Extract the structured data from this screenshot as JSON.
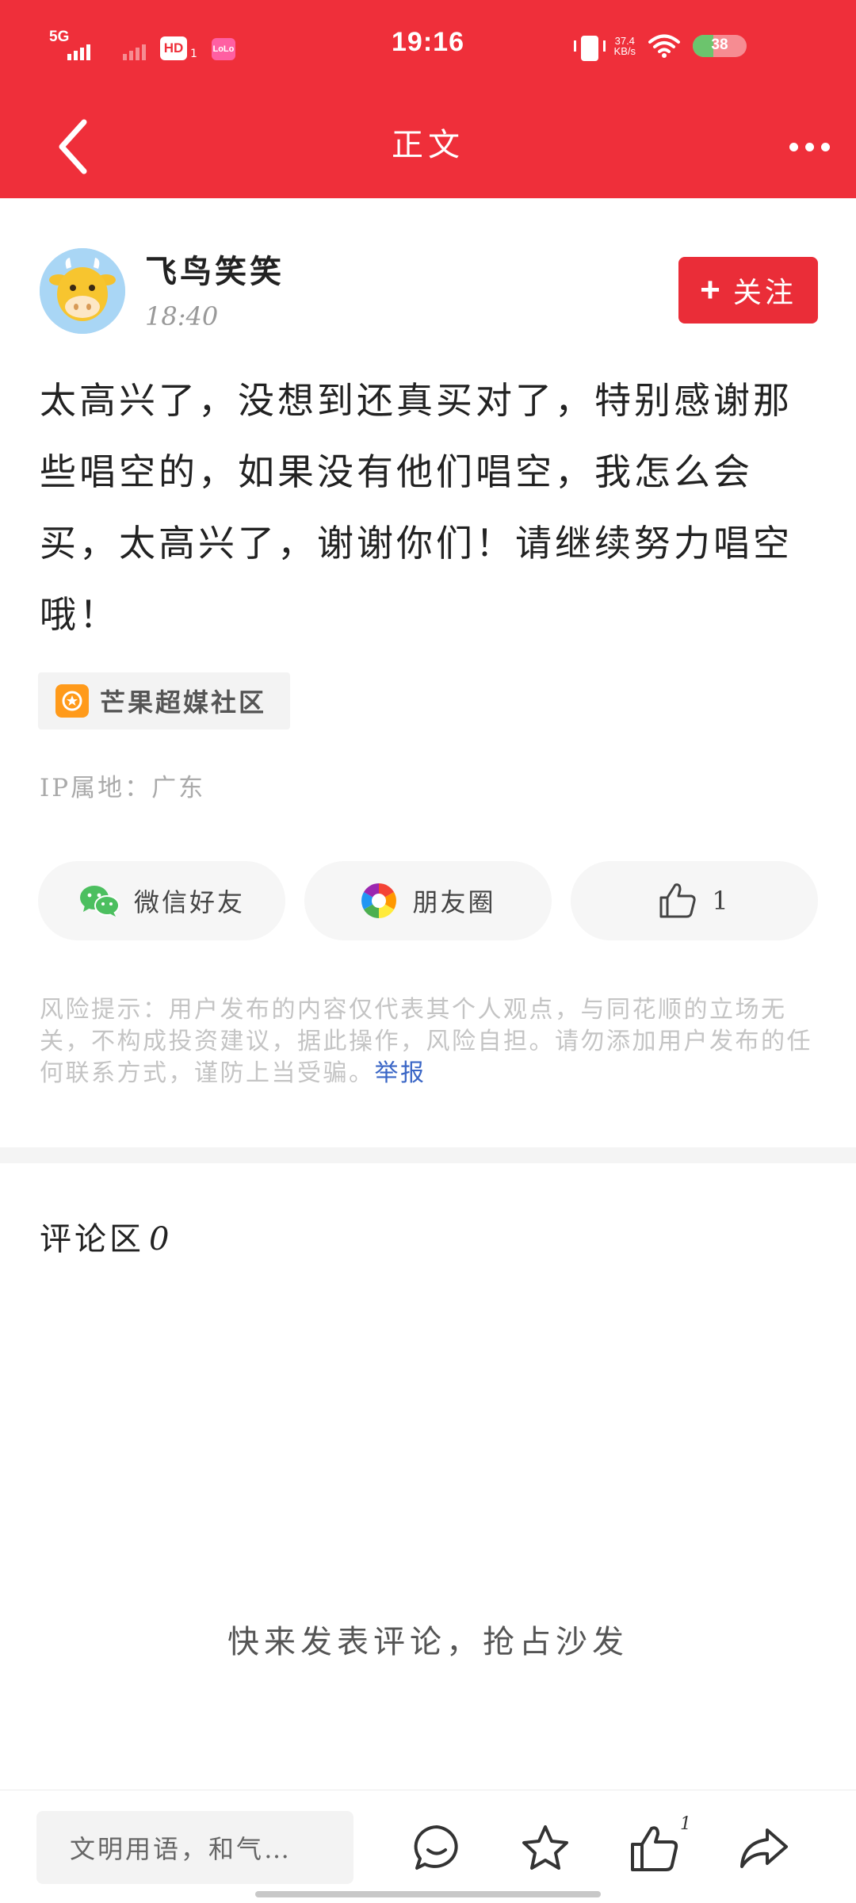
{
  "status_bar": {
    "time": "19:16",
    "network_label": "5G",
    "hd_label": "HD",
    "hd_sub": "1",
    "app_badge": "LoLo",
    "speed_value": "37.4",
    "speed_unit": "KB/s",
    "battery": "38",
    "battery_level_percent": 38
  },
  "nav": {
    "title": "正文"
  },
  "post": {
    "author": "飞鸟笑笑",
    "time": "18:40",
    "follow_label": "关注",
    "body": "太高兴了，没想到还真买对了，特别感谢那些唱空的，如果没有他们唱空，我怎么会买，太高兴了，谢谢你们！请继续努力唱空哦！",
    "topic": "芒果超媒社区",
    "ip_location": "IP属地：广东"
  },
  "share": {
    "wechat_label": "微信好友",
    "moments_label": "朋友圈",
    "like_count": "1"
  },
  "risk": {
    "text": "风险提示：用户发布的内容仅代表其个人观点，与同花顺的立场无关，不构成投资建议，据此操作，风险自担。请勿添加用户发布的任何联系方式，谨防上当受骗。",
    "report_label": "举报"
  },
  "comments": {
    "title": "评论区",
    "count": "0",
    "empty_hint": "快来发表评论，抢占沙发"
  },
  "bottom_bar": {
    "input_placeholder": "文明用语，和气…",
    "like_count": "1"
  },
  "colors": {
    "header": "#ef2f3a",
    "follow_button": "#ea2d38",
    "report_link": "#3a66c6",
    "topic_icon": "#ff9a1a",
    "wechat_green": "#4cbf5f"
  },
  "icons": {
    "back": "chevron-left-icon",
    "more": "more-dots-icon",
    "topic": "mango-topic-icon",
    "wechat": "wechat-icon",
    "moments": "moments-icon",
    "like": "thumbs-up-icon",
    "comment": "comment-bubble-icon",
    "favorite": "star-icon",
    "share": "share-arrow-icon"
  }
}
